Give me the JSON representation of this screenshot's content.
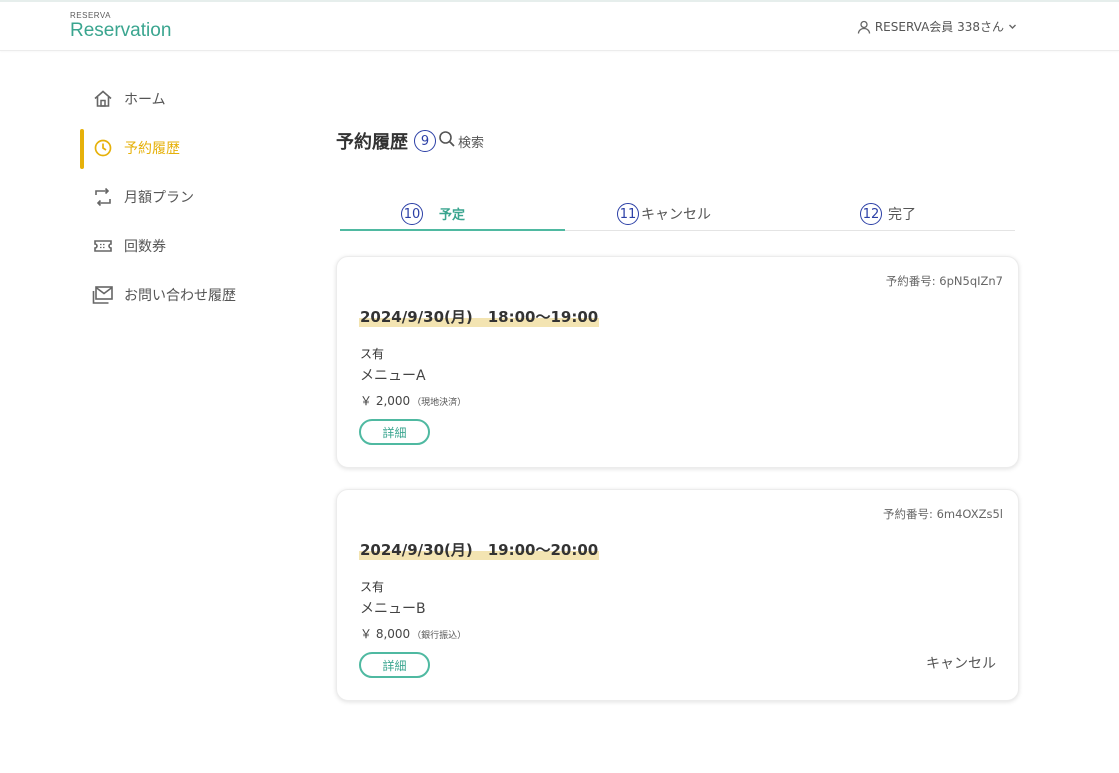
{
  "header": {
    "logo_small": "RESERVA",
    "logo_big": "Reservation",
    "user_label": "RESERVA会員 338さん"
  },
  "sidebar": {
    "items": [
      {
        "label": "ホーム",
        "icon": "home-icon"
      },
      {
        "label": "予約履歴",
        "icon": "clock-icon",
        "active": true
      },
      {
        "label": "月額プラン",
        "icon": "repeat-icon"
      },
      {
        "label": "回数券",
        "icon": "ticket-icon"
      },
      {
        "label": "お問い合わせ履歴",
        "icon": "mail-icon"
      }
    ]
  },
  "main": {
    "title": "予約履歴",
    "title_marker": "⑨",
    "search_label": "検索",
    "tabs": [
      {
        "marker": "⑩",
        "label": "予定",
        "active": true
      },
      {
        "marker": "⑪",
        "label": "キャンセル"
      },
      {
        "marker": "⑫",
        "label": "完了"
      }
    ],
    "reservations": [
      {
        "number": "予約番号: 6pN5qIZn7",
        "datetime": "2024/9/30(月)　18:00～19:00",
        "store": "ス有",
        "menu": "メニューA",
        "price": "￥ 2,000",
        "payment": "（現地決済）",
        "detail_label": "詳細",
        "cancel_label": ""
      },
      {
        "number": "予約番号: 6m4OXZs5l",
        "datetime": "2024/9/30(月)　19:00～20:00",
        "store": "ス有",
        "menu": "メニューB",
        "price": "￥ 8,000",
        "payment": "（銀行振込）",
        "detail_label": "詳細",
        "cancel_label": "キャンセル"
      }
    ]
  },
  "colors": {
    "accent": "#4fb9a1",
    "active_nav": "#e6b10a",
    "highlight": "#f3e4b2",
    "marker": "#2b3fa6"
  }
}
